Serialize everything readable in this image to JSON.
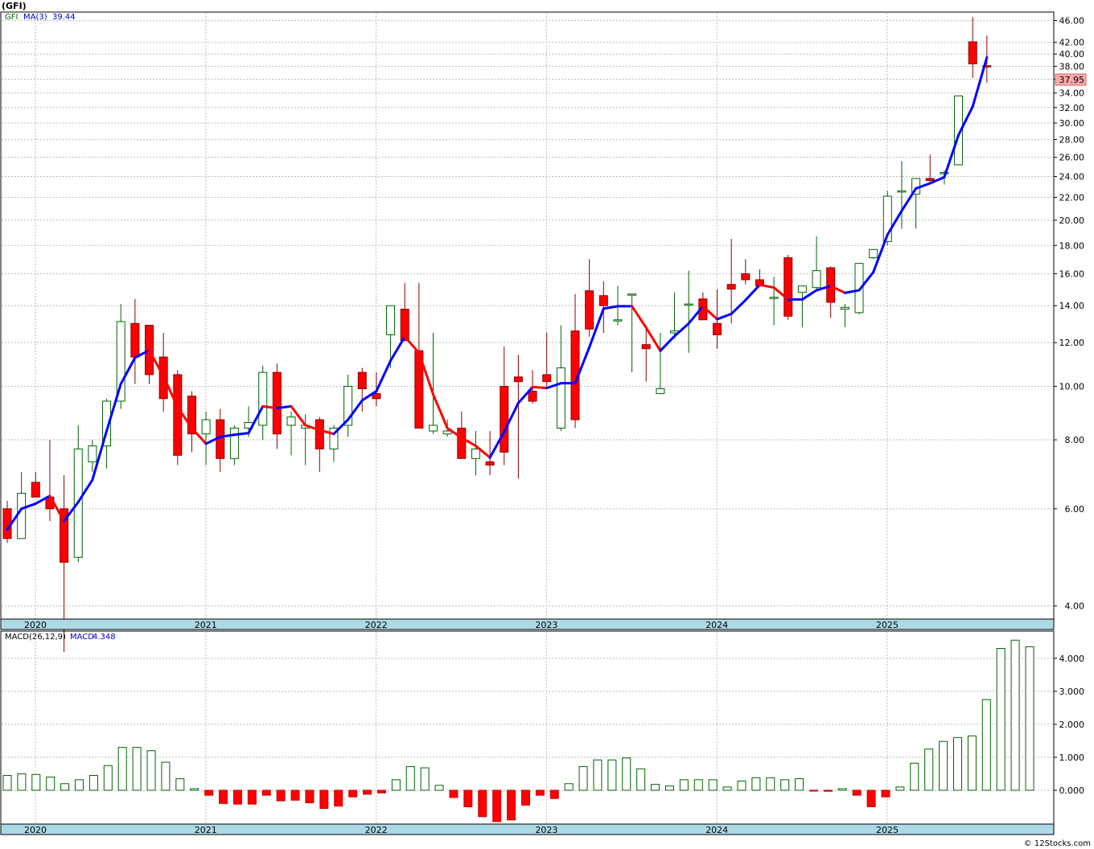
{
  "ticker_label": "(GFI)",
  "price_legend": {
    "symbol": "GFI",
    "ma_label": "MA(3)",
    "ma_value": "39.44"
  },
  "macd_legend": {
    "label": "MACD(26,12,9)",
    "name": "MACD",
    "value": "4.348"
  },
  "last_price_label": "37.95",
  "footer_credit": "© 12Stocks.com",
  "colors": {
    "up_body": "#ffffff",
    "up_border": "#006400",
    "down_body": "#ff0000",
    "down_border": "#8b0000",
    "ma_up": "#0000ff",
    "ma_down": "#ff0000",
    "axis_band": "#add8e6",
    "grid": "#bbbbbb",
    "last_price_box": "#ffaaaa"
  },
  "year_labels": [
    "2020",
    "2021",
    "2022",
    "2023",
    "2024",
    "2025"
  ],
  "chart_data": [
    {
      "type": "candlestick",
      "title": "(GFI)",
      "interval": "monthly",
      "scale": "log",
      "ylim": [
        3.8,
        47.5
      ],
      "y_ticks": [
        "4.00",
        "6.00",
        "8.00",
        "10.00",
        "12.00",
        "14.00",
        "16.00",
        "18.00",
        "20.00",
        "22.00",
        "24.00",
        "26.00",
        "28.00",
        "30.00",
        "32.00",
        "34.00",
        "36.00",
        "38.00",
        "40.00",
        "42.00",
        "46.00"
      ],
      "months": [
        "2020-01",
        "2020-02",
        "2020-03",
        "2020-04",
        "2020-05",
        "2020-06",
        "2020-07",
        "2020-08",
        "2020-09",
        "2020-10",
        "2020-11",
        "2020-12",
        "2021-01",
        "2021-02",
        "2021-03",
        "2021-04",
        "2021-05",
        "2021-06",
        "2021-07",
        "2021-08",
        "2021-09",
        "2021-10",
        "2021-11",
        "2021-12",
        "2022-01",
        "2022-02",
        "2022-03",
        "2022-04",
        "2022-05",
        "2022-06",
        "2022-07",
        "2022-08",
        "2022-09",
        "2022-10",
        "2022-11",
        "2022-12",
        "2023-01",
        "2023-02",
        "2023-03",
        "2023-04",
        "2023-05",
        "2023-06",
        "2023-07",
        "2023-08",
        "2023-09",
        "2023-10",
        "2023-11",
        "2023-12",
        "2024-01",
        "2024-02",
        "2024-03",
        "2024-04",
        "2024-05",
        "2024-06",
        "2024-07",
        "2024-08",
        "2024-09",
        "2024-10",
        "2024-11",
        "2024-12",
        "2025-01",
        "2025-02",
        "2025-03",
        "2025-04",
        "2025-05",
        "2025-06",
        "2025-07",
        "2025-08",
        "2025-09",
        "2025-10"
      ],
      "open": [
        6.0,
        5.3,
        6.7,
        6.3,
        6.0,
        4.9,
        7.3,
        7.8,
        9.4,
        13.0,
        12.9,
        11.3,
        10.5,
        9.6,
        8.2,
        8.7,
        7.4,
        8.4,
        8.5,
        10.6,
        8.5,
        8.4,
        8.7,
        7.7,
        8.5,
        10.6,
        9.7,
        12.4,
        13.8,
        11.6,
        8.3,
        8.2,
        8.4,
        7.4,
        7.3,
        10.0,
        10.4,
        9.8,
        10.5,
        8.4,
        12.6,
        14.9,
        14.6,
        13.2,
        14.7,
        11.9,
        9.7,
        12.5,
        14.1,
        14.4,
        13.0,
        15.3,
        16.0,
        15.6,
        14.5,
        17.1,
        14.8,
        15.1,
        16.4,
        13.8,
        13.6,
        17.1,
        18.3,
        22.6,
        22.3,
        23.8,
        24.3,
        25.2,
        42.1,
        38.1
      ],
      "high": [
        6.2,
        7.0,
        7.0,
        8.0,
        6.9,
        8.5,
        8.0,
        9.5,
        14.1,
        14.4,
        12.9,
        12.5,
        10.7,
        9.8,
        9.0,
        9.1,
        8.5,
        9.2,
        10.9,
        11.0,
        9.0,
        8.9,
        8.8,
        8.5,
        10.5,
        10.8,
        10.6,
        12.8,
        15.4,
        15.4,
        12.5,
        8.7,
        9.0,
        8.3,
        8.3,
        11.8,
        11.4,
        10.7,
        12.5,
        12.9,
        14.7,
        17.0,
        15.5,
        15.2,
        14.7,
        12.9,
        12.5,
        14.8,
        16.2,
        14.8,
        15.0,
        18.5,
        17.0,
        16.3,
        15.8,
        17.3,
        15.1,
        18.7,
        16.5,
        14.1,
        16.4,
        17.5,
        22.6,
        25.6,
        23.6,
        26.3,
        24.6,
        27.1,
        46.7,
        43.2
      ],
      "low": [
        5.2,
        5.3,
        6.4,
        5.7,
        3.3,
        4.8,
        7.0,
        7.1,
        9.1,
        10.1,
        10.1,
        9.0,
        7.2,
        7.6,
        7.2,
        7.0,
        7.2,
        8.1,
        8.0,
        7.7,
        7.5,
        7.2,
        7.0,
        7.3,
        8.1,
        9.0,
        9.2,
        10.8,
        12.6,
        11.6,
        8.2,
        8.1,
        7.4,
        6.9,
        6.9,
        7.2,
        6.8,
        9.3,
        10.0,
        8.3,
        8.4,
        12.3,
        12.5,
        12.9,
        10.6,
        10.2,
        9.8,
        12.2,
        11.5,
        13.2,
        11.7,
        13.0,
        15.3,
        15.2,
        12.9,
        13.2,
        12.8,
        14.9,
        13.3,
        12.8,
        13.5,
        17.0,
        18.0,
        19.3,
        19.3,
        23.5,
        23.2,
        25.2,
        36.2,
        35.5
      ],
      "close": [
        5.3,
        6.4,
        6.3,
        6.0,
        4.8,
        7.7,
        7.8,
        9.4,
        13.1,
        11.3,
        10.5,
        9.5,
        7.5,
        8.2,
        8.7,
        7.4,
        8.4,
        8.6,
        10.6,
        8.2,
        8.8,
        8.5,
        7.7,
        8.4,
        10.0,
        9.9,
        9.5,
        14.0,
        12.1,
        8.4,
        8.5,
        8.3,
        7.4,
        7.7,
        7.2,
        7.6,
        10.2,
        9.4,
        10.2,
        10.8,
        8.7,
        12.7,
        14.0,
        13.2,
        14.7,
        11.7,
        9.9,
        12.6,
        14.1,
        13.2,
        12.4,
        15.0,
        15.6,
        15.2,
        14.5,
        13.4,
        15.2,
        16.2,
        14.2,
        13.9,
        16.7,
        17.7,
        22.1,
        22.6,
        23.8,
        23.6,
        24.4,
        33.6,
        38.4,
        37.95
      ]
    },
    {
      "type": "line",
      "name": "MA(3)",
      "x_ref": "months",
      "values": [
        5.5,
        6.0,
        6.13,
        6.33,
        5.7,
        6.17,
        6.77,
        8.3,
        10.1,
        11.27,
        11.63,
        10.43,
        9.17,
        8.4,
        7.87,
        8.1,
        8.17,
        8.23,
        9.2,
        9.13,
        9.2,
        8.5,
        8.33,
        8.2,
        8.7,
        9.43,
        9.8,
        11.13,
        12.3,
        11.5,
        9.67,
        8.4,
        8.07,
        7.8,
        7.43,
        8.27,
        9.33,
        9.97,
        9.93,
        10.13,
        10.13,
        11.77,
        13.83,
        13.97,
        13.97,
        12.77,
        11.6,
        12.33,
        13.0,
        13.97,
        13.23,
        13.53,
        14.33,
        15.27,
        15.1,
        14.37,
        14.37,
        14.93,
        15.2,
        14.77,
        14.93,
        16.1,
        18.83,
        20.8,
        22.83,
        23.33,
        23.93,
        28.53,
        32.13,
        39.44
      ]
    },
    {
      "type": "bar",
      "name": "MACD",
      "label": "MACD(26,12,9)",
      "x_ref": "months",
      "ylim": [
        -1.0,
        4.8
      ],
      "y_ticks": [
        "0.000",
        "1.000",
        "2.000",
        "3.000",
        "4.000"
      ],
      "values": [
        0.45,
        0.5,
        0.48,
        0.4,
        0.2,
        0.32,
        0.45,
        0.75,
        1.3,
        1.3,
        1.2,
        0.85,
        0.35,
        0.05,
        -0.15,
        -0.4,
        -0.42,
        -0.42,
        -0.15,
        -0.32,
        -0.3,
        -0.38,
        -0.55,
        -0.48,
        -0.2,
        -0.12,
        -0.08,
        0.32,
        0.72,
        0.68,
        0.15,
        -0.22,
        -0.5,
        -0.8,
        -0.95,
        -0.9,
        -0.45,
        -0.15,
        -0.25,
        0.2,
        0.72,
        0.92,
        0.92,
        0.98,
        0.65,
        0.18,
        0.13,
        0.32,
        0.32,
        0.32,
        0.1,
        0.28,
        0.38,
        0.38,
        0.32,
        0.35,
        -0.02,
        -0.03,
        0.05,
        -0.15,
        -0.5,
        -0.2,
        0.1,
        0.82,
        1.25,
        1.48,
        1.6,
        1.65,
        2.75,
        4.3,
        4.55,
        4.35
      ]
    }
  ]
}
